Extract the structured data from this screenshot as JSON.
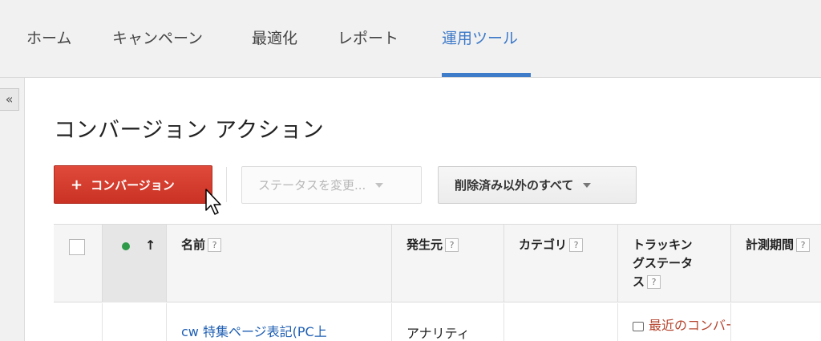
{
  "nav": {
    "tabs": [
      {
        "label": "ホーム"
      },
      {
        "label": "キャンペーン"
      },
      {
        "label": "最適化"
      },
      {
        "label": "レポート"
      },
      {
        "label": "運用ツール",
        "active": true
      }
    ]
  },
  "sidebar": {
    "collapse_label": "«"
  },
  "page": {
    "title": "コンバージョン アクション"
  },
  "toolbar": {
    "add_icon": "+",
    "add_label": "コンバージョン",
    "status_label": "ステータスを変更...",
    "filter_label": "削除済み以外のすべて"
  },
  "table": {
    "sort_icon": "↑",
    "help_mark": "?",
    "columns": {
      "name": "名前",
      "source": "発生元",
      "category": "カテゴリ",
      "tracking_l1": "トラッキン",
      "tracking_l2": "グステータ",
      "tracking_l3": "ス",
      "period": "計測期間"
    },
    "row": {
      "name": "cw 特集ページ表記(PC上",
      "source": "アナリティ",
      "tracking": "最近のコンバージ"
    }
  },
  "colors": {
    "accent": "#3e7bc9",
    "add_button": "#d63e2f",
    "status_enabled": "#2d9a48",
    "tracking_text": "#b5442e"
  }
}
